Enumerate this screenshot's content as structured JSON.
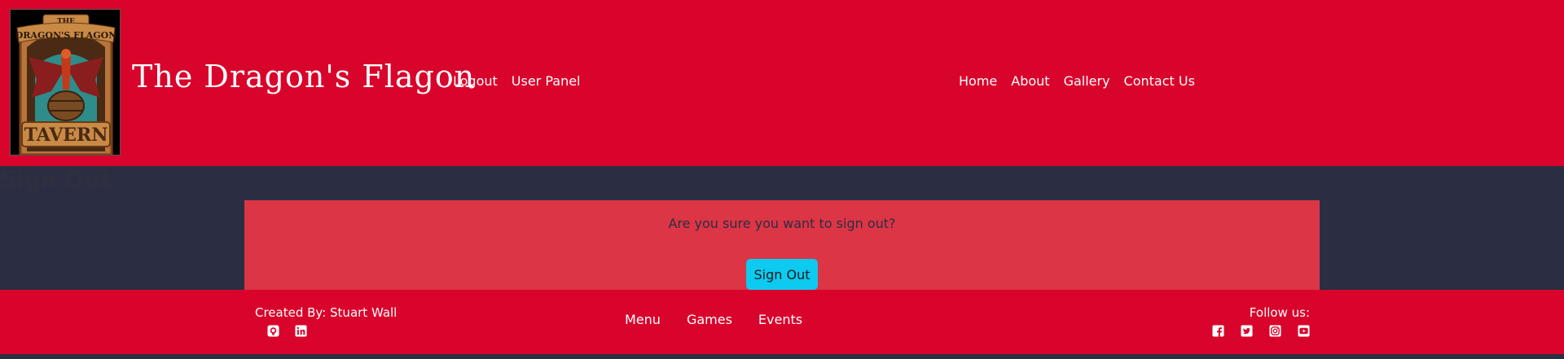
{
  "header": {
    "brand": "The Dragon's Flagon",
    "logo_icon": "dragons-flagon-tavern-logo",
    "logo_text": [
      "THE",
      "DRAGON'S FLAGON",
      "TAVERN"
    ],
    "left_nav": [
      "Logout",
      "User Panel"
    ],
    "right_nav": [
      "Home",
      "About",
      "Gallery",
      "Contact Us"
    ],
    "background": "#d9042b"
  },
  "main": {
    "title": "Sign Out",
    "prompt": "Are you sure you want to sign out?",
    "button_label": "Sign Out",
    "card_color": "#dc3545",
    "button_color": "#0dcaf0",
    "page_background": "#2b2e42"
  },
  "footer": {
    "credit": "Created By: Stuart Wall",
    "credit_icons": [
      "github-icon",
      "linkedin-icon"
    ],
    "nav": [
      "Menu",
      "Games",
      "Events"
    ],
    "follow_label": "Follow us:",
    "social_icons": [
      "facebook-icon",
      "twitter-icon",
      "instagram-icon",
      "youtube-icon"
    ]
  }
}
